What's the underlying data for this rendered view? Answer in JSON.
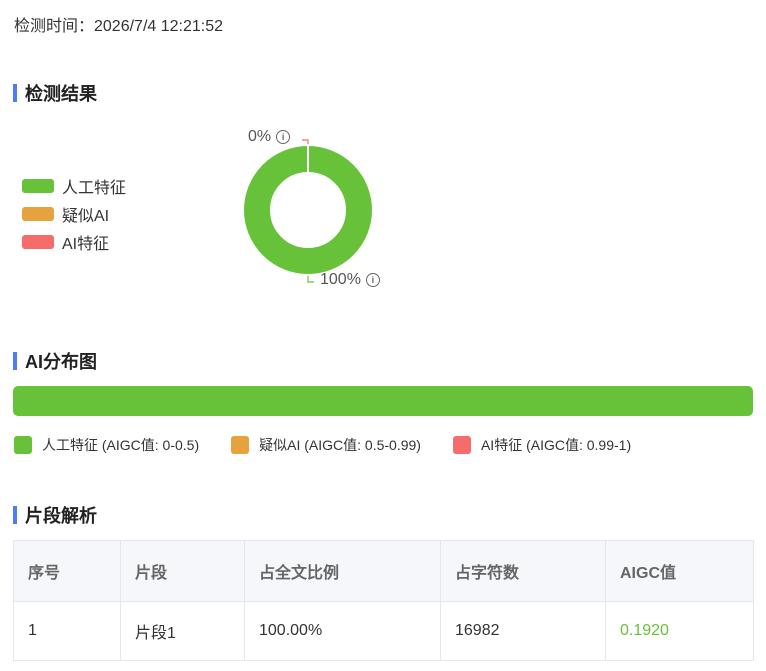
{
  "header": {
    "detect_time": "检测时间：2026/7/4 12:21:52"
  },
  "sections": {
    "result_title": "检测结果",
    "distribution_title": "AI分布图",
    "segments_title": "片段解析"
  },
  "colors": {
    "human": "#67c23a",
    "suspected": "#e6a23c",
    "ai": "#f56c6c",
    "accent": "#4f7cf5"
  },
  "result": {
    "legend": [
      {
        "label": "人工特征",
        "color": "#67c23a"
      },
      {
        "label": "疑似AI",
        "color": "#e6a23c"
      },
      {
        "label": "AI特征",
        "color": "#f56c6c"
      }
    ],
    "donut": {
      "values": [
        100,
        0,
        0
      ],
      "top_label": "0%",
      "bottom_label": "100%"
    }
  },
  "distribution": {
    "human_fraction": 1.0,
    "legend": [
      {
        "label": "人工特征 (AIGC值: 0-0.5)",
        "color": "#67c23a"
      },
      {
        "label": "疑似AI (AIGC值: 0.5-0.99)",
        "color": "#e6a23c"
      },
      {
        "label": "AI特征 (AIGC值: 0.99-1)",
        "color": "#f56c6c"
      }
    ]
  },
  "table": {
    "headers": [
      "序号",
      "片段",
      "占全文比例",
      "占字符数",
      "AIGC值"
    ],
    "rows": [
      {
        "index": "1",
        "segment": "片段1",
        "ratio": "100.00%",
        "chars": "16982",
        "aigc": "0.1920"
      }
    ]
  }
}
